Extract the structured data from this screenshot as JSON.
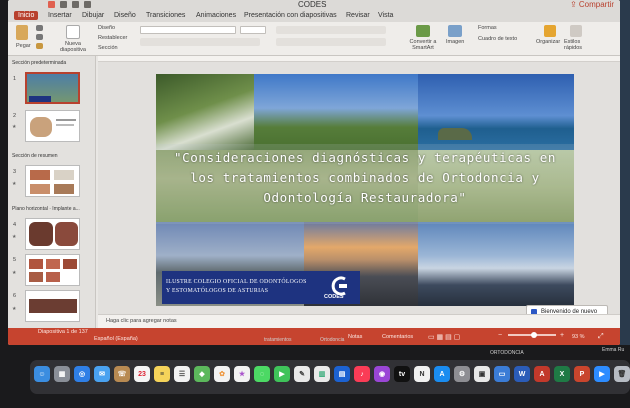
{
  "window": {
    "title": "CODES",
    "share_label": "Compartir"
  },
  "tabs": [
    "Inicio",
    "Insertar",
    "Dibujar",
    "Diseño",
    "Transiciones",
    "Animaciones",
    "Presentación con diapositivas",
    "Revisar",
    "Vista"
  ],
  "active_tab": "Inicio",
  "ribbon": {
    "paste": "Pegar",
    "new_slide": "Nueva diapositiva",
    "layout": "Diseño",
    "reset": "Restablecer",
    "section": "Sección",
    "convert_smartart": "Convertir a SmartArt",
    "image": "Imagen",
    "shapes": "Formas",
    "textbox": "Cuadro de texto",
    "arrange": "Organizar",
    "quick_styles": "Estilos rápidos"
  },
  "panel": {
    "sections": [
      {
        "title": "Sección predeterminada",
        "slides": [
          1,
          2
        ]
      },
      {
        "title": "Sección de resumen",
        "slides": [
          3
        ]
      },
      {
        "title": "Plano horizontal · Implante a...",
        "slides": [
          4,
          5,
          6
        ]
      }
    ]
  },
  "slide": {
    "title": "\"Consideraciones diagnósticas y terapéuticas en los tratamientos combinados de Ortodoncia y Odontología Restauradora\"",
    "logo_line1": "ILUSTRE COLEGIO OFICIAL DE ODONTÓLOGOS",
    "logo_line2": "Y ESTOMATÓLOGOS DE ASTURIAS",
    "logo_brand": "CODES"
  },
  "notes_placeholder": "Haga clic para agregar notas",
  "welcome_button": "Bienvenido de nuevo",
  "status": {
    "slide_position": "Diapositiva 1 de 137",
    "language": "Español (España)",
    "notes": "Notas",
    "comments": "Comentarios",
    "zoom": "93 %",
    "zoom_level": 0.55
  },
  "desktop_labels": [
    "tratamientos",
    "Ortodoncia",
    "ORTODONCIA",
    "Emma Ru"
  ],
  "colors": {
    "accent": "#c6442f",
    "logo_blue": "#1e3380"
  },
  "dock_apps": [
    "finder",
    "launchpad",
    "safari",
    "mail",
    "contacts",
    "calendar",
    "notes",
    "reminders",
    "maps",
    "photos",
    "messages",
    "facetime",
    "keynote",
    "music",
    "podcasts",
    "tv",
    "app-store",
    "system-preferences",
    "word",
    "excel",
    "powerpoint",
    "zoom",
    "trash"
  ]
}
